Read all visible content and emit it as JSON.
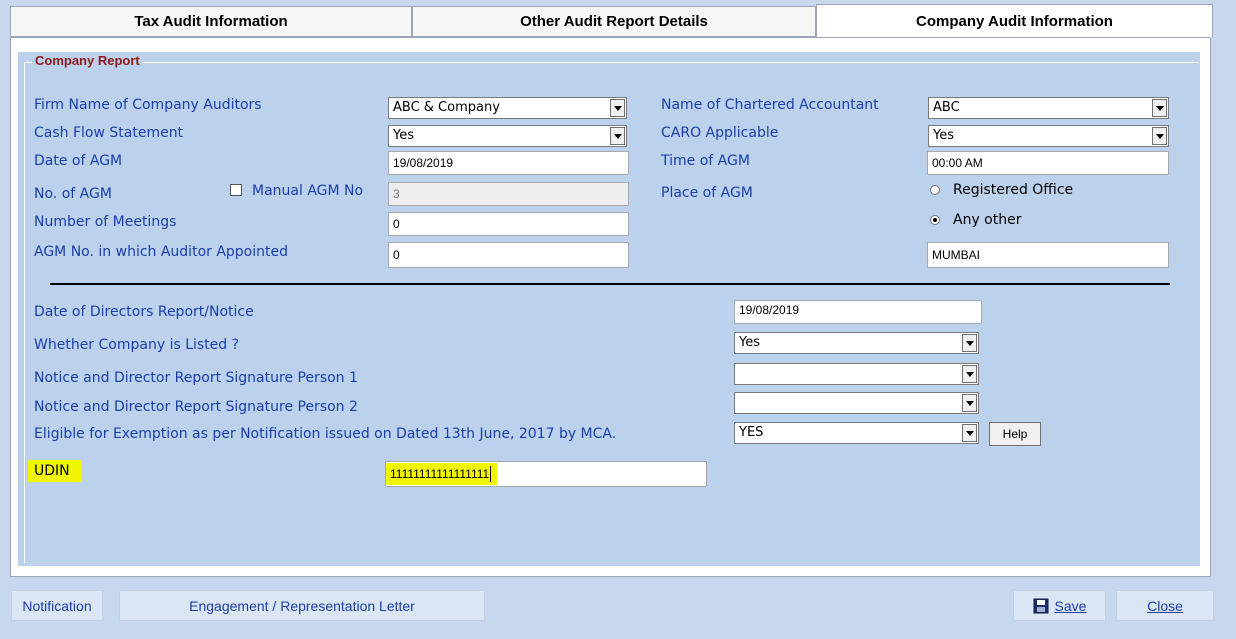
{
  "tabs": [
    {
      "label": "Tax Audit Information"
    },
    {
      "label": "Other Audit Report Details"
    },
    {
      "label": "Company Audit Information"
    }
  ],
  "group": {
    "legend": "Company Report"
  },
  "left": {
    "firm_name": {
      "label": "Firm Name of Company Auditors",
      "value": "ABC & Company"
    },
    "cash_flow": {
      "label": "Cash Flow Statement",
      "value": "Yes"
    },
    "date_agm": {
      "label": "Date of AGM",
      "value": "19/08/2019"
    },
    "no_agm": {
      "label": "No. of AGM",
      "manual_label": "Manual AGM No",
      "value": "3"
    },
    "meetings": {
      "label": "Number of Meetings",
      "value": "0"
    },
    "agm_auditor": {
      "label": "AGM No. in which Auditor Appointed",
      "value": "0"
    }
  },
  "right": {
    "ca_name": {
      "label": "Name of Chartered Accountant",
      "value": "ABC"
    },
    "caro": {
      "label": "CARO Applicable",
      "value": "Yes"
    },
    "time_agm": {
      "label": "Time of AGM",
      "value": "00:00 AM"
    },
    "place_agm": {
      "label": "Place of AGM",
      "option1": "Registered Office",
      "option2": "Any other",
      "value": "MUMBAI"
    }
  },
  "lower": {
    "directors_date": {
      "label": "Date of Directors Report/Notice",
      "value": "19/08/2019"
    },
    "listed": {
      "label": "Whether Company is Listed ?",
      "value": "Yes"
    },
    "sig1": {
      "label": "Notice and Director Report Signature Person 1",
      "value": ""
    },
    "sig2": {
      "label": "Notice and Director Report Signature Person 2",
      "value": ""
    },
    "exemption": {
      "label": "Eligible for Exemption as per Notification issued on Dated 13th June, 2017 by MCA.",
      "value": "YES",
      "help": "Help"
    },
    "udin": {
      "label": "UDIN",
      "value": "11111111111111111"
    }
  },
  "footer": {
    "notification": "Notification",
    "engagement": "Engagement / Representation Letter",
    "save": "Save",
    "close": "Close"
  },
  "colors": {
    "panel": "#bcd1ec",
    "label": "#1a3ea8",
    "highlight": "#f0f500",
    "legend": "#8b1a1a"
  }
}
